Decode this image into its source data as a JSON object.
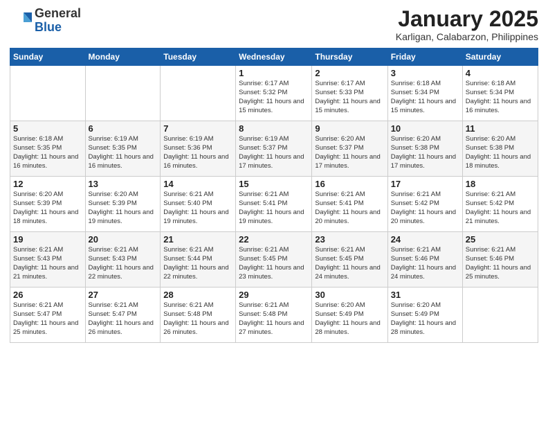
{
  "logo": {
    "general": "General",
    "blue": "Blue"
  },
  "header": {
    "month": "January 2025",
    "location": "Karligan, Calabarzon, Philippines"
  },
  "days_of_week": [
    "Sunday",
    "Monday",
    "Tuesday",
    "Wednesday",
    "Thursday",
    "Friday",
    "Saturday"
  ],
  "weeks": [
    [
      {
        "day": "",
        "info": ""
      },
      {
        "day": "",
        "info": ""
      },
      {
        "day": "",
        "info": ""
      },
      {
        "day": "1",
        "info": "Sunrise: 6:17 AM\nSunset: 5:32 PM\nDaylight: 11 hours\nand 15 minutes."
      },
      {
        "day": "2",
        "info": "Sunrise: 6:17 AM\nSunset: 5:33 PM\nDaylight: 11 hours\nand 15 minutes."
      },
      {
        "day": "3",
        "info": "Sunrise: 6:18 AM\nSunset: 5:34 PM\nDaylight: 11 hours\nand 15 minutes."
      },
      {
        "day": "4",
        "info": "Sunrise: 6:18 AM\nSunset: 5:34 PM\nDaylight: 11 hours\nand 16 minutes."
      }
    ],
    [
      {
        "day": "5",
        "info": "Sunrise: 6:18 AM\nSunset: 5:35 PM\nDaylight: 11 hours\nand 16 minutes."
      },
      {
        "day": "6",
        "info": "Sunrise: 6:19 AM\nSunset: 5:35 PM\nDaylight: 11 hours\nand 16 minutes."
      },
      {
        "day": "7",
        "info": "Sunrise: 6:19 AM\nSunset: 5:36 PM\nDaylight: 11 hours\nand 16 minutes."
      },
      {
        "day": "8",
        "info": "Sunrise: 6:19 AM\nSunset: 5:37 PM\nDaylight: 11 hours\nand 17 minutes."
      },
      {
        "day": "9",
        "info": "Sunrise: 6:20 AM\nSunset: 5:37 PM\nDaylight: 11 hours\nand 17 minutes."
      },
      {
        "day": "10",
        "info": "Sunrise: 6:20 AM\nSunset: 5:38 PM\nDaylight: 11 hours\nand 17 minutes."
      },
      {
        "day": "11",
        "info": "Sunrise: 6:20 AM\nSunset: 5:38 PM\nDaylight: 11 hours\nand 18 minutes."
      }
    ],
    [
      {
        "day": "12",
        "info": "Sunrise: 6:20 AM\nSunset: 5:39 PM\nDaylight: 11 hours\nand 18 minutes."
      },
      {
        "day": "13",
        "info": "Sunrise: 6:20 AM\nSunset: 5:39 PM\nDaylight: 11 hours\nand 19 minutes."
      },
      {
        "day": "14",
        "info": "Sunrise: 6:21 AM\nSunset: 5:40 PM\nDaylight: 11 hours\nand 19 minutes."
      },
      {
        "day": "15",
        "info": "Sunrise: 6:21 AM\nSunset: 5:41 PM\nDaylight: 11 hours\nand 19 minutes."
      },
      {
        "day": "16",
        "info": "Sunrise: 6:21 AM\nSunset: 5:41 PM\nDaylight: 11 hours\nand 20 minutes."
      },
      {
        "day": "17",
        "info": "Sunrise: 6:21 AM\nSunset: 5:42 PM\nDaylight: 11 hours\nand 20 minutes."
      },
      {
        "day": "18",
        "info": "Sunrise: 6:21 AM\nSunset: 5:42 PM\nDaylight: 11 hours\nand 21 minutes."
      }
    ],
    [
      {
        "day": "19",
        "info": "Sunrise: 6:21 AM\nSunset: 5:43 PM\nDaylight: 11 hours\nand 21 minutes."
      },
      {
        "day": "20",
        "info": "Sunrise: 6:21 AM\nSunset: 5:43 PM\nDaylight: 11 hours\nand 22 minutes."
      },
      {
        "day": "21",
        "info": "Sunrise: 6:21 AM\nSunset: 5:44 PM\nDaylight: 11 hours\nand 22 minutes."
      },
      {
        "day": "22",
        "info": "Sunrise: 6:21 AM\nSunset: 5:45 PM\nDaylight: 11 hours\nand 23 minutes."
      },
      {
        "day": "23",
        "info": "Sunrise: 6:21 AM\nSunset: 5:45 PM\nDaylight: 11 hours\nand 24 minutes."
      },
      {
        "day": "24",
        "info": "Sunrise: 6:21 AM\nSunset: 5:46 PM\nDaylight: 11 hours\nand 24 minutes."
      },
      {
        "day": "25",
        "info": "Sunrise: 6:21 AM\nSunset: 5:46 PM\nDaylight: 11 hours\nand 25 minutes."
      }
    ],
    [
      {
        "day": "26",
        "info": "Sunrise: 6:21 AM\nSunset: 5:47 PM\nDaylight: 11 hours\nand 25 minutes."
      },
      {
        "day": "27",
        "info": "Sunrise: 6:21 AM\nSunset: 5:47 PM\nDaylight: 11 hours\nand 26 minutes."
      },
      {
        "day": "28",
        "info": "Sunrise: 6:21 AM\nSunset: 5:48 PM\nDaylight: 11 hours\nand 26 minutes."
      },
      {
        "day": "29",
        "info": "Sunrise: 6:21 AM\nSunset: 5:48 PM\nDaylight: 11 hours\nand 27 minutes."
      },
      {
        "day": "30",
        "info": "Sunrise: 6:20 AM\nSunset: 5:49 PM\nDaylight: 11 hours\nand 28 minutes."
      },
      {
        "day": "31",
        "info": "Sunrise: 6:20 AM\nSunset: 5:49 PM\nDaylight: 11 hours\nand 28 minutes."
      },
      {
        "day": "",
        "info": ""
      }
    ]
  ]
}
